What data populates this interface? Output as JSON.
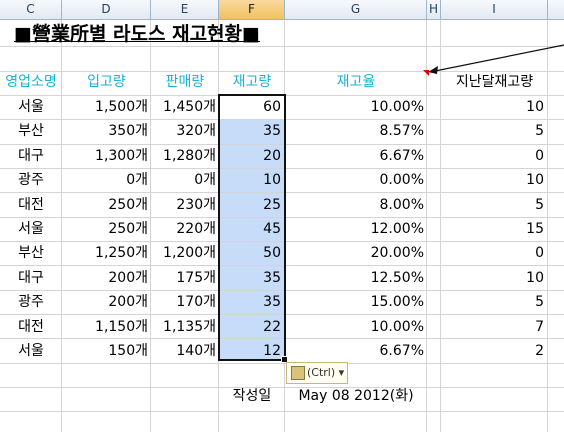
{
  "columns": [
    "C",
    "D",
    "E",
    "F",
    "G",
    "H",
    "I"
  ],
  "selected_column": "F",
  "title": "■營業所별 라도스 재고현황■",
  "headers": {
    "office": "영업소명",
    "incoming": "입고량",
    "sales": "판매량",
    "stock": "재고량",
    "ratio": "재고율",
    "last_month": "지난달재고량"
  },
  "rows": [
    {
      "office": "서울",
      "incoming": "1,500개",
      "sales": "1,450개",
      "stock": "60",
      "ratio": "10.00%",
      "last_month": "10"
    },
    {
      "office": "부산",
      "incoming": "350개",
      "sales": "320개",
      "stock": "35",
      "ratio": "8.57%",
      "last_month": "5"
    },
    {
      "office": "대구",
      "incoming": "1,300개",
      "sales": "1,280개",
      "stock": "20",
      "ratio": "6.67%",
      "last_month": "0"
    },
    {
      "office": "광주",
      "incoming": "0개",
      "sales": "0개",
      "stock": "10",
      "ratio": "0.00%",
      "last_month": "10"
    },
    {
      "office": "대전",
      "incoming": "250개",
      "sales": "230개",
      "stock": "25",
      "ratio": "8.00%",
      "last_month": "5"
    },
    {
      "office": "서울",
      "incoming": "250개",
      "sales": "220개",
      "stock": "45",
      "ratio": "12.00%",
      "last_month": "15"
    },
    {
      "office": "부산",
      "incoming": "1,250개",
      "sales": "1,200개",
      "stock": "50",
      "ratio": "20.00%",
      "last_month": "0"
    },
    {
      "office": "대구",
      "incoming": "200개",
      "sales": "175개",
      "stock": "35",
      "ratio": "12.50%",
      "last_month": "10"
    },
    {
      "office": "광주",
      "incoming": "200개",
      "sales": "170개",
      "stock": "35",
      "ratio": "15.00%",
      "last_month": "5"
    },
    {
      "office": "대전",
      "incoming": "1,150개",
      "sales": "1,135개",
      "stock": "22",
      "ratio": "10.00%",
      "last_month": "7"
    },
    {
      "office": "서울",
      "incoming": "150개",
      "sales": "140개",
      "stock": "12",
      "ratio": "6.67%",
      "last_month": "2"
    }
  ],
  "footer": {
    "label": "작성일",
    "date": "May 08 2012(화)"
  },
  "paste_options": {
    "label": "(Ctrl)",
    "icon": "clipboard-icon"
  },
  "colors": {
    "header_text": "#19b3d6",
    "selection_fill": "#c6dcf8",
    "comment_marker": "#e00000"
  }
}
